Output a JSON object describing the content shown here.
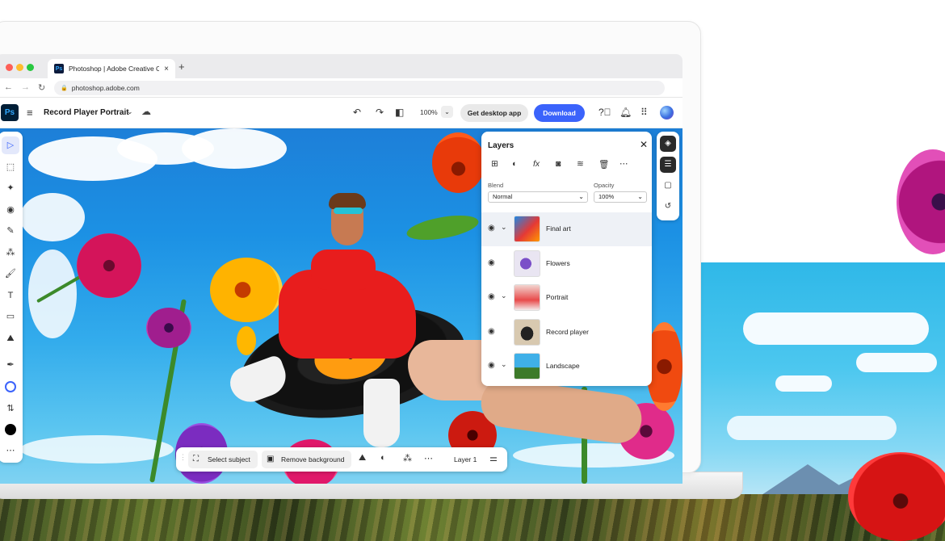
{
  "browser": {
    "tab_title": "Photoshop | Adobe Creative C",
    "tab_app_badge": "Ps",
    "url": "photoshop.adobe.com",
    "new_tab": "+",
    "close_tab": "×"
  },
  "app": {
    "logo": "Ps",
    "document_title": "Record Player Portrait",
    "zoom": "100%",
    "get_desktop_label": "Get desktop app",
    "download_label": "Download"
  },
  "layers_panel": {
    "title": "Layers",
    "blend_label": "Blend",
    "blend_value": "Normal",
    "opacity_label": "Opacity",
    "opacity_value": "100%",
    "layers": [
      {
        "name": "Final art",
        "selected": true,
        "expandable": true
      },
      {
        "name": "Flowers",
        "selected": false,
        "expandable": false
      },
      {
        "name": "Portrait",
        "selected": false,
        "expandable": true
      },
      {
        "name": "Record player",
        "selected": false,
        "expandable": false
      },
      {
        "name": "Landscape",
        "selected": false,
        "expandable": true
      }
    ]
  },
  "context_bar": {
    "select_subject": "Select subject",
    "remove_background": "Remove background",
    "layer_label": "Layer 1"
  },
  "colors": {
    "accent": "#3b63fb",
    "ps_dark": "#001e36",
    "ps_blue": "#31a8ff"
  }
}
